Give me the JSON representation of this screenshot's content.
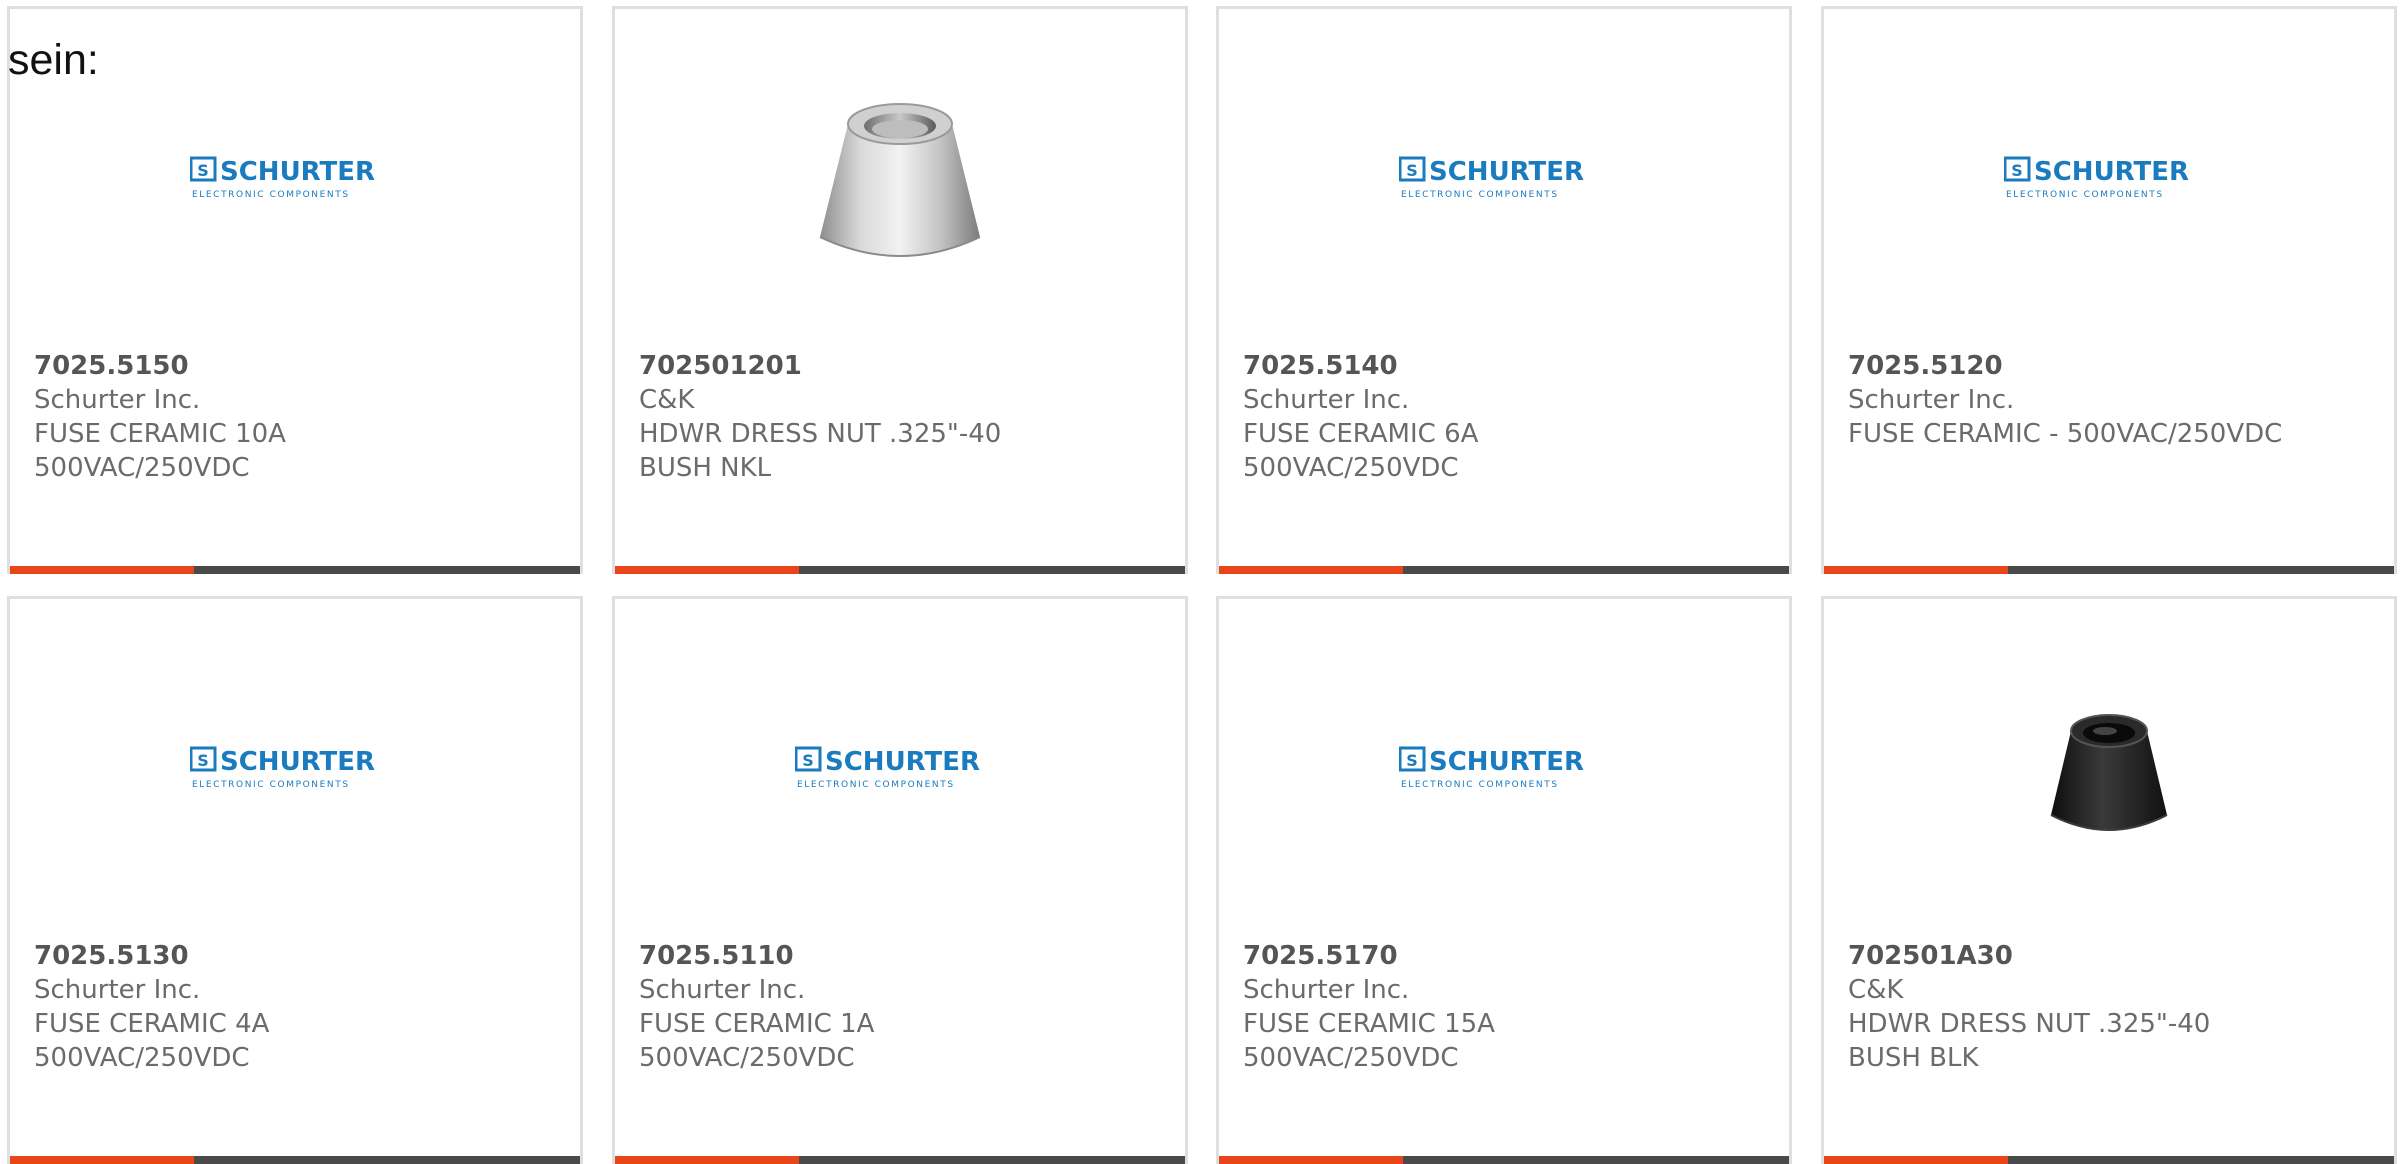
{
  "intro_text": "sein:",
  "brand": {
    "accent_color": "#e8461a",
    "bar_color": "#4a4a4a",
    "logo_wordmark": "SCHURTER",
    "logo_tagline": "ELECTRONIC COMPONENTS"
  },
  "products": [
    {
      "part": "7025.5150",
      "maker": "Schurter Inc.",
      "desc1": "FUSE CERAMIC 10A",
      "desc2": "500VAC/250VDC",
      "image": "schurter-logo"
    },
    {
      "part": "702501201",
      "maker": "C&K",
      "desc1": "HDWR DRESS NUT .325\"-40",
      "desc2": "BUSH NKL",
      "image": "nickel-dress-nut"
    },
    {
      "part": "7025.5140",
      "maker": "Schurter Inc.",
      "desc1": "FUSE CERAMIC 6A",
      "desc2": "500VAC/250VDC",
      "image": "schurter-logo"
    },
    {
      "part": "7025.5120",
      "maker": "Schurter Inc.",
      "desc1": "FUSE CERAMIC - 500VAC/250VDC",
      "desc2": "",
      "image": "schurter-logo"
    },
    {
      "part": "7025.5130",
      "maker": "Schurter Inc.",
      "desc1": "FUSE CERAMIC 4A",
      "desc2": "500VAC/250VDC",
      "image": "schurter-logo"
    },
    {
      "part": "7025.5110",
      "maker": "Schurter Inc.",
      "desc1": "FUSE CERAMIC 1A",
      "desc2": "500VAC/250VDC",
      "image": "schurter-logo"
    },
    {
      "part": "7025.5170",
      "maker": "Schurter Inc.",
      "desc1": "FUSE CERAMIC 15A",
      "desc2": "500VAC/250VDC",
      "image": "schurter-logo"
    },
    {
      "part": "702501A30",
      "maker": "C&K",
      "desc1": "HDWR DRESS NUT .325\"-40",
      "desc2": "BUSH BLK",
      "image": "black-dress-nut"
    }
  ]
}
